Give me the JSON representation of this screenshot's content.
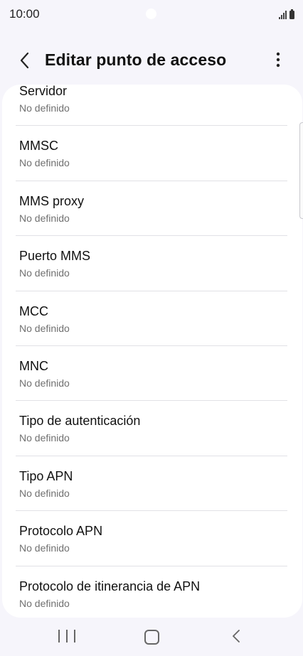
{
  "status_bar": {
    "time": "10:00",
    "icons": [
      "signal-icon",
      "battery-icon"
    ]
  },
  "header": {
    "back_icon": "chevron-left-icon",
    "title": "Editar punto de acceso",
    "more_icon": "more-vertical-icon"
  },
  "list": {
    "items": [
      {
        "title": "Servidor",
        "value": "No definido"
      },
      {
        "title": "MMSC",
        "value": "No definido"
      },
      {
        "title": "MMS proxy",
        "value": "No definido"
      },
      {
        "title": "Puerto MMS",
        "value": "No definido"
      },
      {
        "title": "MCC",
        "value": "No definido"
      },
      {
        "title": "MNC",
        "value": "No definido"
      },
      {
        "title": "Tipo de autenticación",
        "value": "No definido"
      },
      {
        "title": "Tipo APN",
        "value": "No definido"
      },
      {
        "title": "Protocolo APN",
        "value": "No definido"
      },
      {
        "title": "Protocolo de itinerancia de APN",
        "value": "No definido"
      }
    ]
  },
  "nav_bar": {
    "icons": [
      "recents-icon",
      "home-icon",
      "back-icon"
    ]
  },
  "colors": {
    "background": "#f6f5fb",
    "card": "#ffffff",
    "secondary_text": "#707070",
    "divider": "#e1e1e6"
  }
}
